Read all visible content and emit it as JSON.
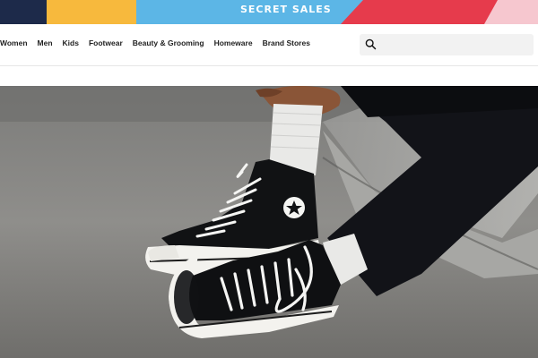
{
  "banner": {
    "text": "SECRET SALES"
  },
  "nav": {
    "items": [
      "Women",
      "Men",
      "Kids",
      "Footwear",
      "Beauty & Grooming",
      "Homeware",
      "Brand Stores"
    ]
  },
  "search": {
    "placeholder": ""
  },
  "colors": {
    "banner_navy": "#1d2a4a",
    "banner_yellow": "#f7b93d",
    "banner_blue": "#5cb6e6",
    "banner_red": "#e63b4c",
    "banner_pink": "#f6c7cf"
  },
  "hero": {
    "image": "sneakers-photo"
  }
}
